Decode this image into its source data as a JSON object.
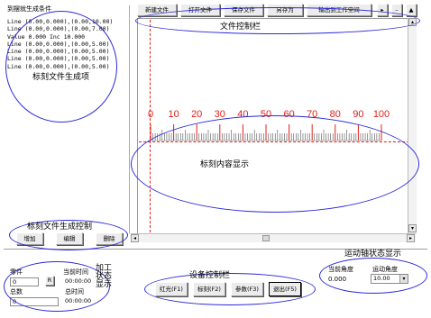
{
  "file_list": {
    "title": "到摆就生成条件",
    "lines": [
      "Line  (0.00,0.000),(0.00,10.00)",
      "Line  (0.00,0.000),(0.00,7.00)",
      "Value  0.000 Inc  10.000",
      "Line  (0.00,0.000),(0.00,5.00)",
      "Line  (0.00,0.000),(0.00,5.00)",
      "Line  (0.00,0.000),(0.00,5.00)",
      "Line  (0.00,0.000),(0.00,5.00)"
    ]
  },
  "toolbar": {
    "new_label": "新建文件",
    "open_label": "打开文件",
    "save_label": "保存文件",
    "save_as_label": "另存为",
    "export_label": "输出到工作空间",
    "arrow_right": "▸",
    "minimize": "–",
    "up": "▲"
  },
  "ruler": {
    "labels": [
      "0",
      "10",
      "20",
      "30",
      "40",
      "50",
      "60",
      "70",
      "80",
      "90",
      "100"
    ],
    "minor_per_major": 10,
    "label_color": "#e0201a",
    "tick_color": "#e0201a"
  },
  "file_buttons": {
    "add_label": "增加",
    "edit_label": "编辑",
    "delete_label": "删除"
  },
  "status": {
    "part_label": "零件",
    "part_value": "0",
    "current_time_label": "当前时间",
    "current_time_value": "00:00:00",
    "reset_label": "R",
    "total_label": "总数",
    "total_value": "0",
    "total_time_label": "总时间",
    "total_time_value": "00:00:00"
  },
  "device": {
    "red_label": "红光(F1)",
    "mark_label": "标刻(F2)",
    "param_label": "参数(F3)",
    "exit_label": "退出(F5)"
  },
  "motion": {
    "current_angle_label": "当前角度",
    "current_angle_value": "0.000",
    "motion_angle_label": "运动角度",
    "motion_angle_value": "10.00"
  },
  "annotations": {
    "file_gen": "标刻文件生成项",
    "file_ctrl": "文件控制栏",
    "content": "标刻内容显示",
    "gen_ctrl": "标刻文件生成控制",
    "device_ctrl": "设备控制栏",
    "motion_status": "运动轴状态显示",
    "process_status_1": "加工",
    "process_status_2": "状态",
    "process_status_3": "显示"
  },
  "colors": {
    "annotation_ellipse": "#2a2ad8",
    "ruler_red": "#e0201a"
  }
}
